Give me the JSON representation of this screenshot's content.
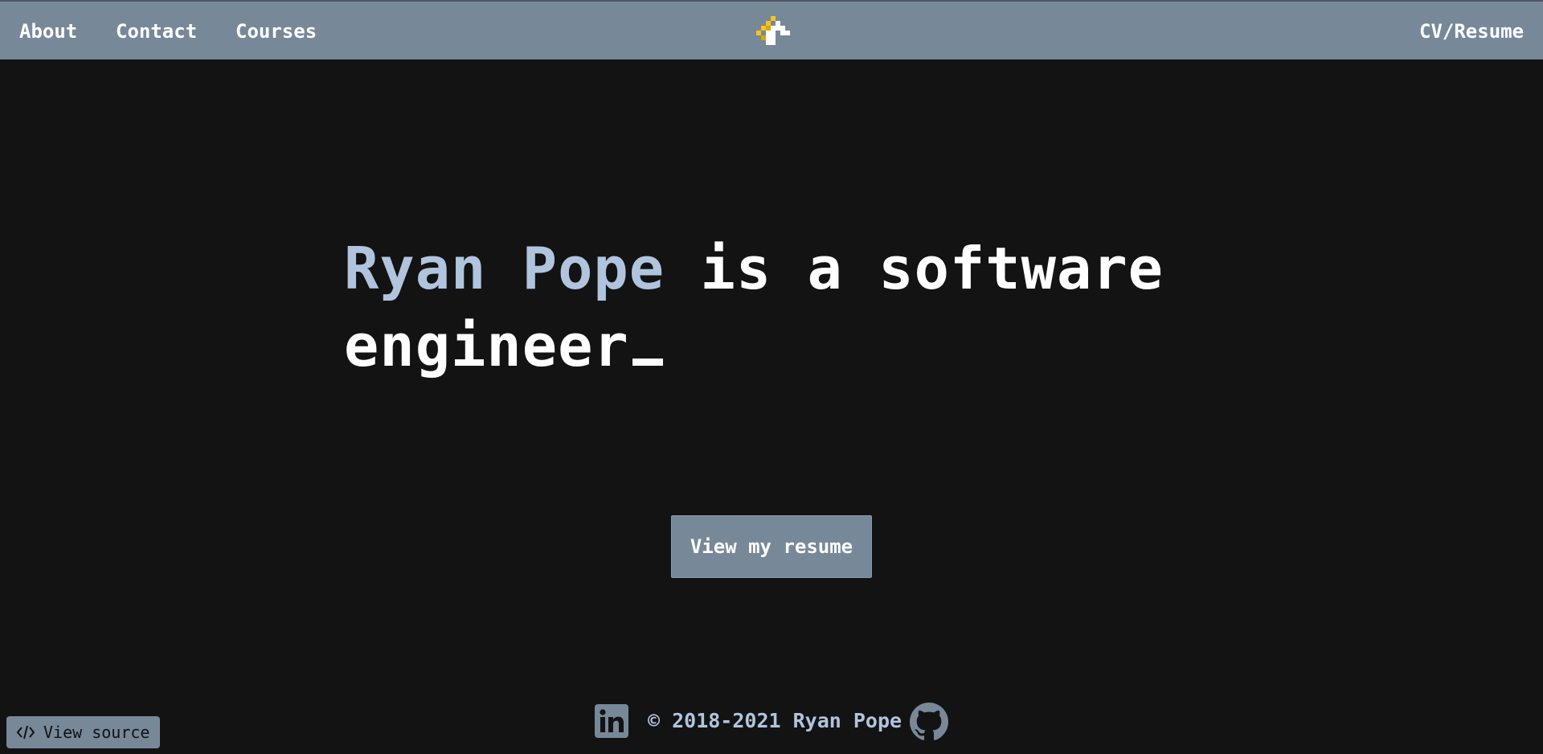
{
  "nav": {
    "items": [
      {
        "label": "About"
      },
      {
        "label": "Contact"
      },
      {
        "label": "Courses"
      }
    ],
    "right_label": "CV/Resume",
    "logo_icon": "pixel-logo-icon"
  },
  "hero": {
    "name": "Ryan Pope",
    "rest": " is a software engineer"
  },
  "cta": {
    "label": "View my resume"
  },
  "footer": {
    "copyright": "© 2018-2021 Ryan Pope",
    "linkedin_icon": "linkedin-icon",
    "github_icon": "github-icon"
  },
  "view_source": {
    "label": "View source",
    "icon": "code-icon"
  },
  "colors": {
    "background": "#131313",
    "navbar": "#778899",
    "accent_name": "#b0c4de",
    "text": "#ffffff",
    "logo_yellow": "#f5c518"
  }
}
